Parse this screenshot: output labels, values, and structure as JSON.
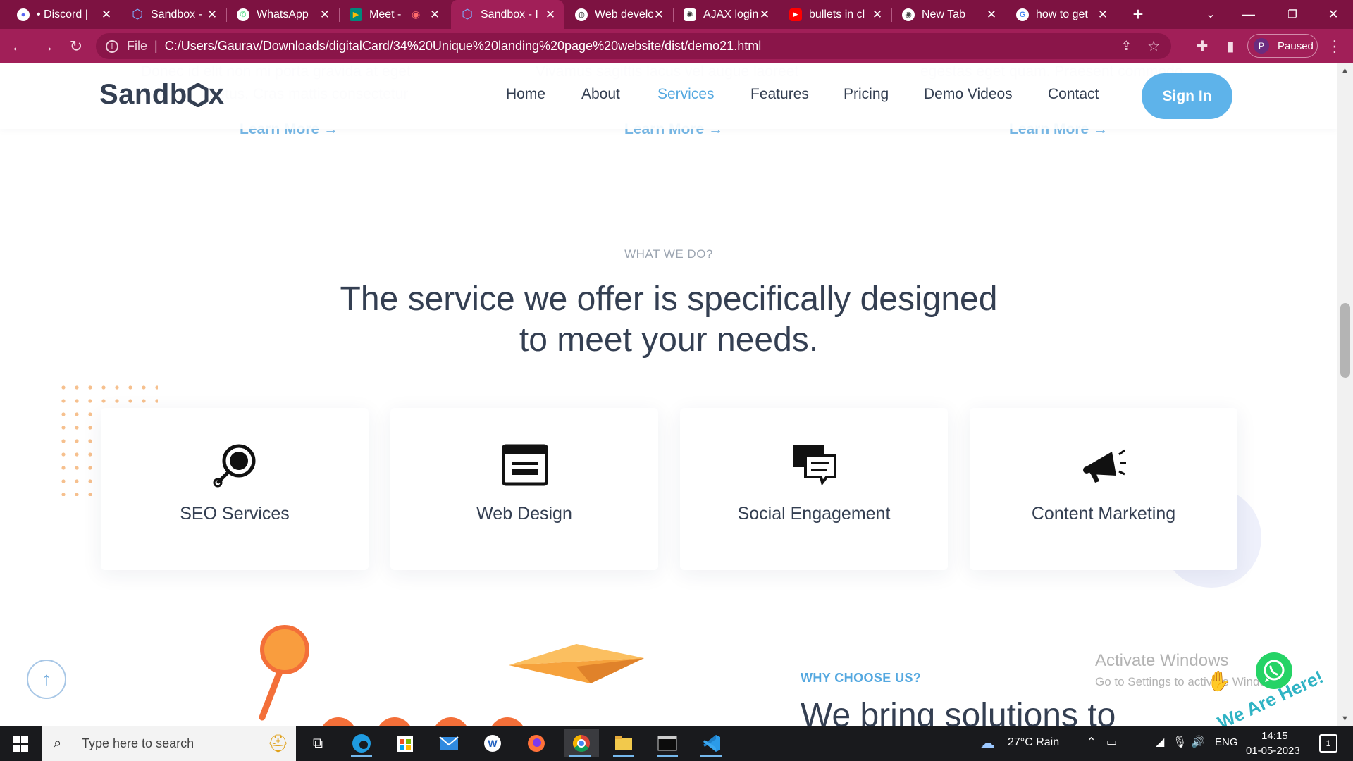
{
  "browser": {
    "tabs": [
      {
        "title": "• Discord |",
        "icon": "discord-icon",
        "color": "#ffffff"
      },
      {
        "title": "Sandbox - I",
        "icon": "sandbox-hex-icon",
        "color": "#3f78e0"
      },
      {
        "title": "WhatsApp",
        "icon": "whatsapp-icon",
        "color": "#25d366"
      },
      {
        "title": "Meet -",
        "icon": "meet-icon",
        "color": "#00897b"
      },
      {
        "title": "Sandbox - I",
        "icon": "sandbox-hex-icon",
        "color": "#3f78e0",
        "active": true
      },
      {
        "title": "Web develop",
        "icon": "globe-icon",
        "color": "#ffffff"
      },
      {
        "title": "AJAX login",
        "icon": "chatgpt-icon",
        "color": "#ffffff"
      },
      {
        "title": "bullets in cl",
        "icon": "youtube-icon",
        "color": "#ff0000"
      },
      {
        "title": "New Tab",
        "icon": "chrome-icon",
        "color": "#ffffff"
      },
      {
        "title": "how to get",
        "icon": "google-icon",
        "color": "#ffffff"
      }
    ],
    "address": {
      "scheme_label": "File",
      "url": "C:/Users/Gaurav/Downloads/digitalCard/34%20Unique%20landing%20page%20website/dist/demo21.html"
    },
    "profile": {
      "initial": "P",
      "status": "Paused"
    }
  },
  "site": {
    "logo": "Sandbox",
    "nav": [
      "Home",
      "About",
      "Services",
      "Features",
      "Pricing",
      "Demo Videos",
      "Contact"
    ],
    "active_nav": "Services",
    "signin": "Sign In",
    "learn_more": "Learn More →",
    "eyebrow": "WHAT WE DO?",
    "headline_line1": "The service we offer is specifically designed",
    "headline_line2": "to meet your needs.",
    "services": [
      {
        "label": "SEO Services",
        "icon": "seo-search-icon"
      },
      {
        "label": "Web Design",
        "icon": "browser-window-icon"
      },
      {
        "label": "Social Engagement",
        "icon": "chat-bubbles-icon"
      },
      {
        "label": "Content Marketing",
        "icon": "megaphone-icon"
      }
    ],
    "why_eyebrow": "WHY CHOOSE US?",
    "why_headline": "We bring solutions to",
    "whatsapp_badge": "We Are Here!"
  },
  "windows": {
    "activate_title": "Activate Windows",
    "activate_sub": "Go to Settings to activate Windows."
  },
  "taskbar": {
    "search_placeholder": "Type here to search",
    "weather": "27°C  Rain",
    "language": "ENG",
    "time": "14:15",
    "date": "01-05-2023",
    "notification_count": "1"
  },
  "colors": {
    "accent": "#54a8e0",
    "tab_strip": "#7d1241",
    "toolbar": "#a11f58",
    "text_dark": "#343f52",
    "dot_orange": "#f6c08e"
  }
}
